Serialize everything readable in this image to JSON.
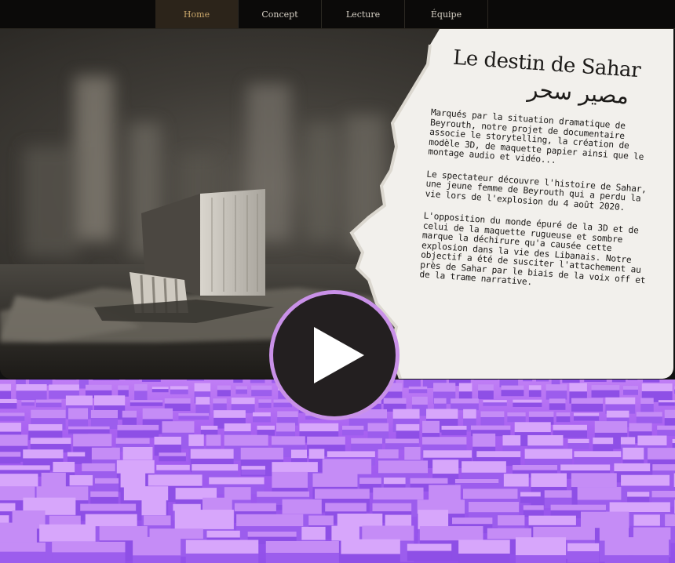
{
  "nav": {
    "items": [
      {
        "label": "Home",
        "active": true
      },
      {
        "label": "Concept",
        "active": false
      },
      {
        "label": "Lecture",
        "active": false
      },
      {
        "label": "Équipe",
        "active": false
      }
    ]
  },
  "hero": {
    "title": "Le destin de Sahar",
    "title_arabic": "مصير سحر",
    "paragraphs": [
      "Marqués par la situation dramatique de Beyrouth, notre projet de documentaire associe le storytelling, la création de modèle 3D, de maquette papier ainsi que le montage audio et vidéo...",
      "Le spectateur découvre l'histoire de Sahar, une jeune femme de Beyrouth qui a perdu la vie lors de l'explosion du 4 août 2020.",
      "L'opposition du monde épuré de la 3D et de celui de la maquette rugueuse et sombre marque la déchirure qu'a causée cette explosion dans la vie des Libanais. Notre objectif a été de susciter l'attachement au près de Sahar par le biais de la voix off et de la trame narrative."
    ]
  },
  "play_button": {
    "icon": "play-icon"
  },
  "colors": {
    "accent": "#c991e8",
    "city": "#a760f1",
    "nav_active": "#c9a66a"
  }
}
